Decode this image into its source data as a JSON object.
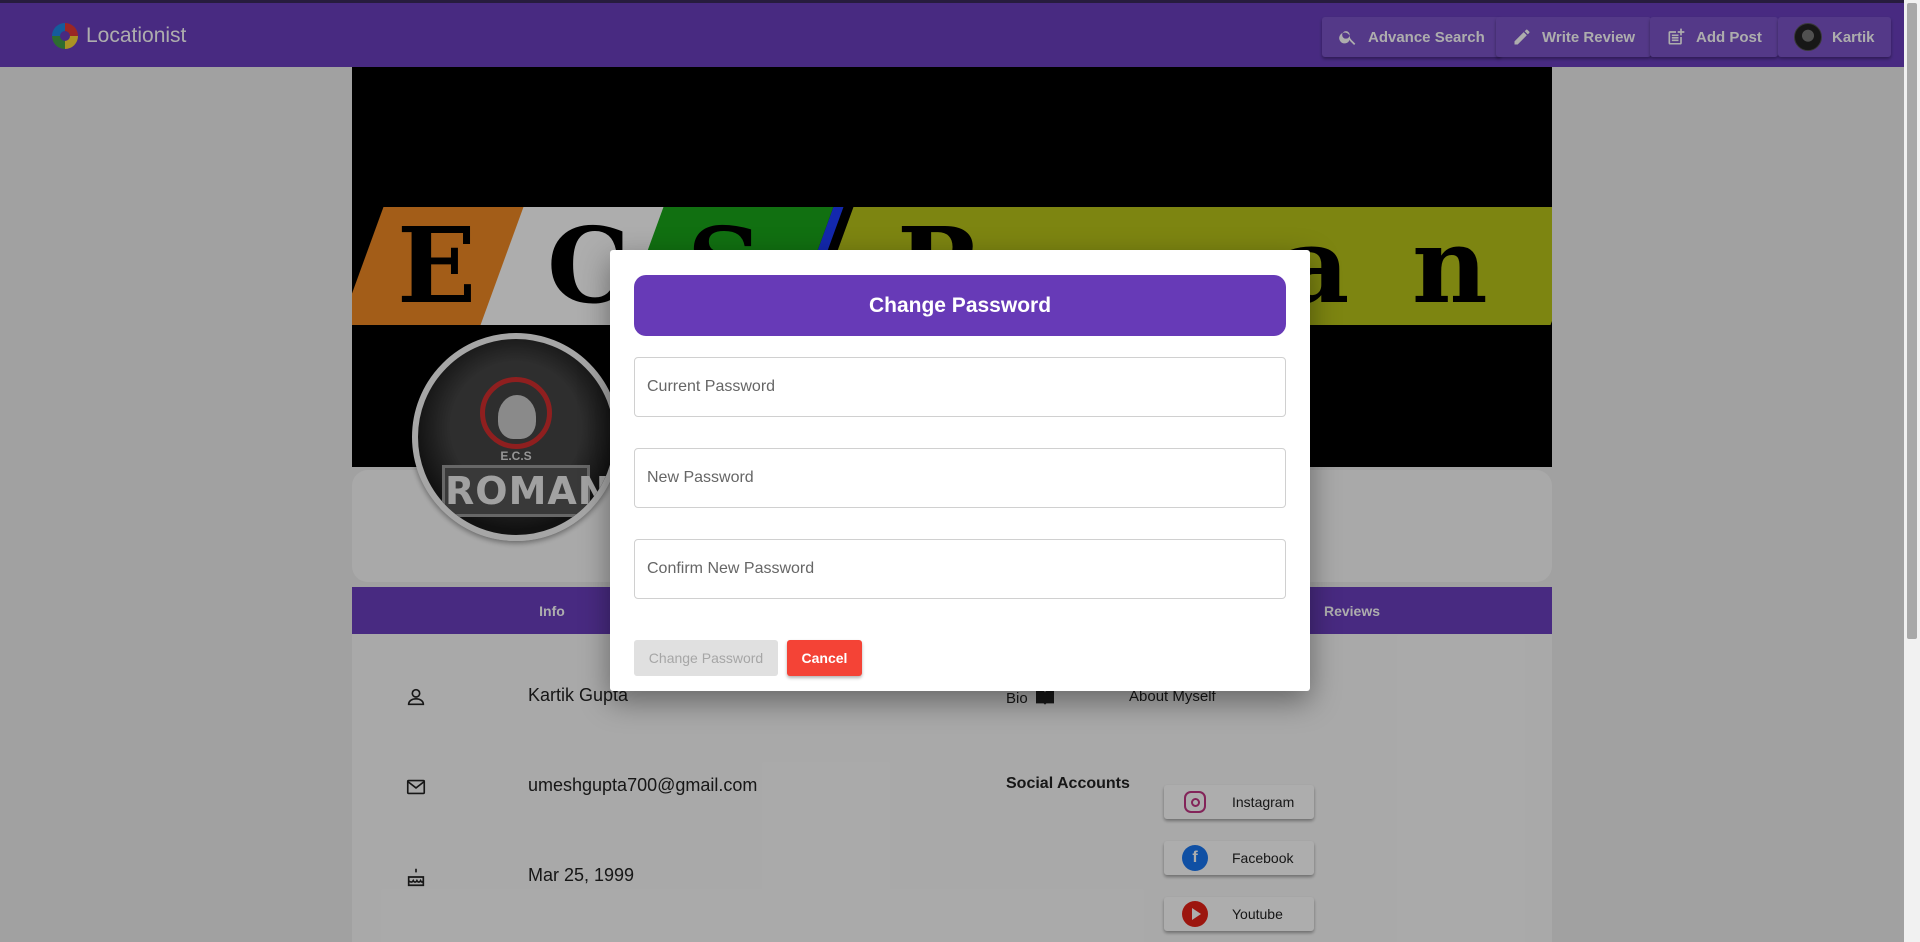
{
  "app": {
    "brand": "Locationist"
  },
  "topbar": {
    "advance_search": "Advance Search",
    "write_review": "Write Review",
    "add_post": "Add Post",
    "user_name": "Kartik"
  },
  "banner": {
    "letters": [
      "E",
      "C",
      "S",
      "R",
      "a",
      "n"
    ]
  },
  "avatar": {
    "subtitle": "E.C.S",
    "name": "ROMAN"
  },
  "tabs": [
    {
      "label": "Info"
    },
    {
      "label": "Reviews"
    }
  ],
  "info": {
    "full_name": "Kartik Gupta",
    "email": "umeshgupta700@gmail.com",
    "birthday": "Mar 25, 1999",
    "bio_label": "Bio",
    "bio_value": "About Myself",
    "social_title": "Social Accounts",
    "social": [
      {
        "label": "Instagram",
        "icon": "instagram-icon",
        "color": "#c13584"
      },
      {
        "label": "Facebook",
        "icon": "facebook-icon",
        "color": "#1877f2"
      },
      {
        "label": "Youtube",
        "icon": "youtube-icon",
        "color": "#e62117"
      }
    ]
  },
  "modal": {
    "title": "Change Password",
    "current_placeholder": "Current Password",
    "new_placeholder": "New Password",
    "confirm_placeholder": "Confirm New Password",
    "submit_label": "Change Password",
    "cancel_label": "Cancel"
  },
  "colors": {
    "primary": "#6a3fbf",
    "modal_header": "#673ab7",
    "cancel": "#f44336"
  }
}
